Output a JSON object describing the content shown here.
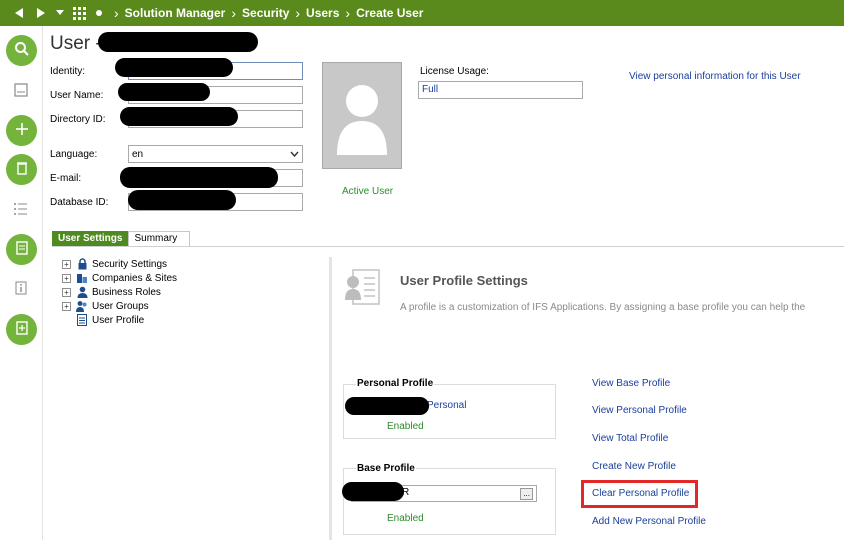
{
  "nav": {
    "breadcrumbs": [
      "Solution Manager",
      "Security",
      "Users",
      "Create User"
    ]
  },
  "page": {
    "title": "User -"
  },
  "form": {
    "identity_label": "Identity:",
    "username_label": "User Name:",
    "directory_label": "Directory ID:",
    "language_label": "Language:",
    "language_value": "en",
    "email_label": "E-mail:",
    "database_label": "Database ID:",
    "license_label": "License Usage:",
    "license_value": "Full",
    "view_personal_link": "View personal information for this User",
    "active_user": "Active User"
  },
  "tabs": [
    "User Settings",
    "Summary"
  ],
  "tree": {
    "items": [
      "Security Settings",
      "Companies & Sites",
      "Business Roles",
      "User Groups",
      "User Profile"
    ]
  },
  "profile": {
    "title": "User Profile Settings",
    "description": "A profile is a customization of IFS Applications. By assigning a base profile you can help the",
    "personal_title": "Personal Profile",
    "personal_value_suffix": "Personal",
    "personal_status": "Enabled",
    "base_title": "Base Profile",
    "base_value_suffix": "R",
    "base_button": "...",
    "base_status": "Enabled",
    "links": [
      "View Base Profile",
      "View Personal Profile",
      "View Total Profile",
      "Create New Profile",
      "Clear Personal Profile",
      "Add New Personal Profile"
    ]
  },
  "colors": {
    "topbar": "#5a8a1c",
    "side_icon": "#74b33c",
    "tab_active": "#4f8a21",
    "link": "#1a3e9b",
    "enabled": "#2e8a2e",
    "highlight": "#e32727"
  },
  "icons": {
    "back": "back-arrow-icon",
    "forward": "forward-arrow-icon",
    "menu": "dropdown-caret-icon",
    "apps": "apps-grid-icon",
    "dot": "dot-icon",
    "search": "search-icon",
    "add": "plus-icon",
    "delete": "trash-icon",
    "list": "list-icon",
    "details": "document-icon",
    "info": "info-icon",
    "new": "new-document-icon"
  }
}
